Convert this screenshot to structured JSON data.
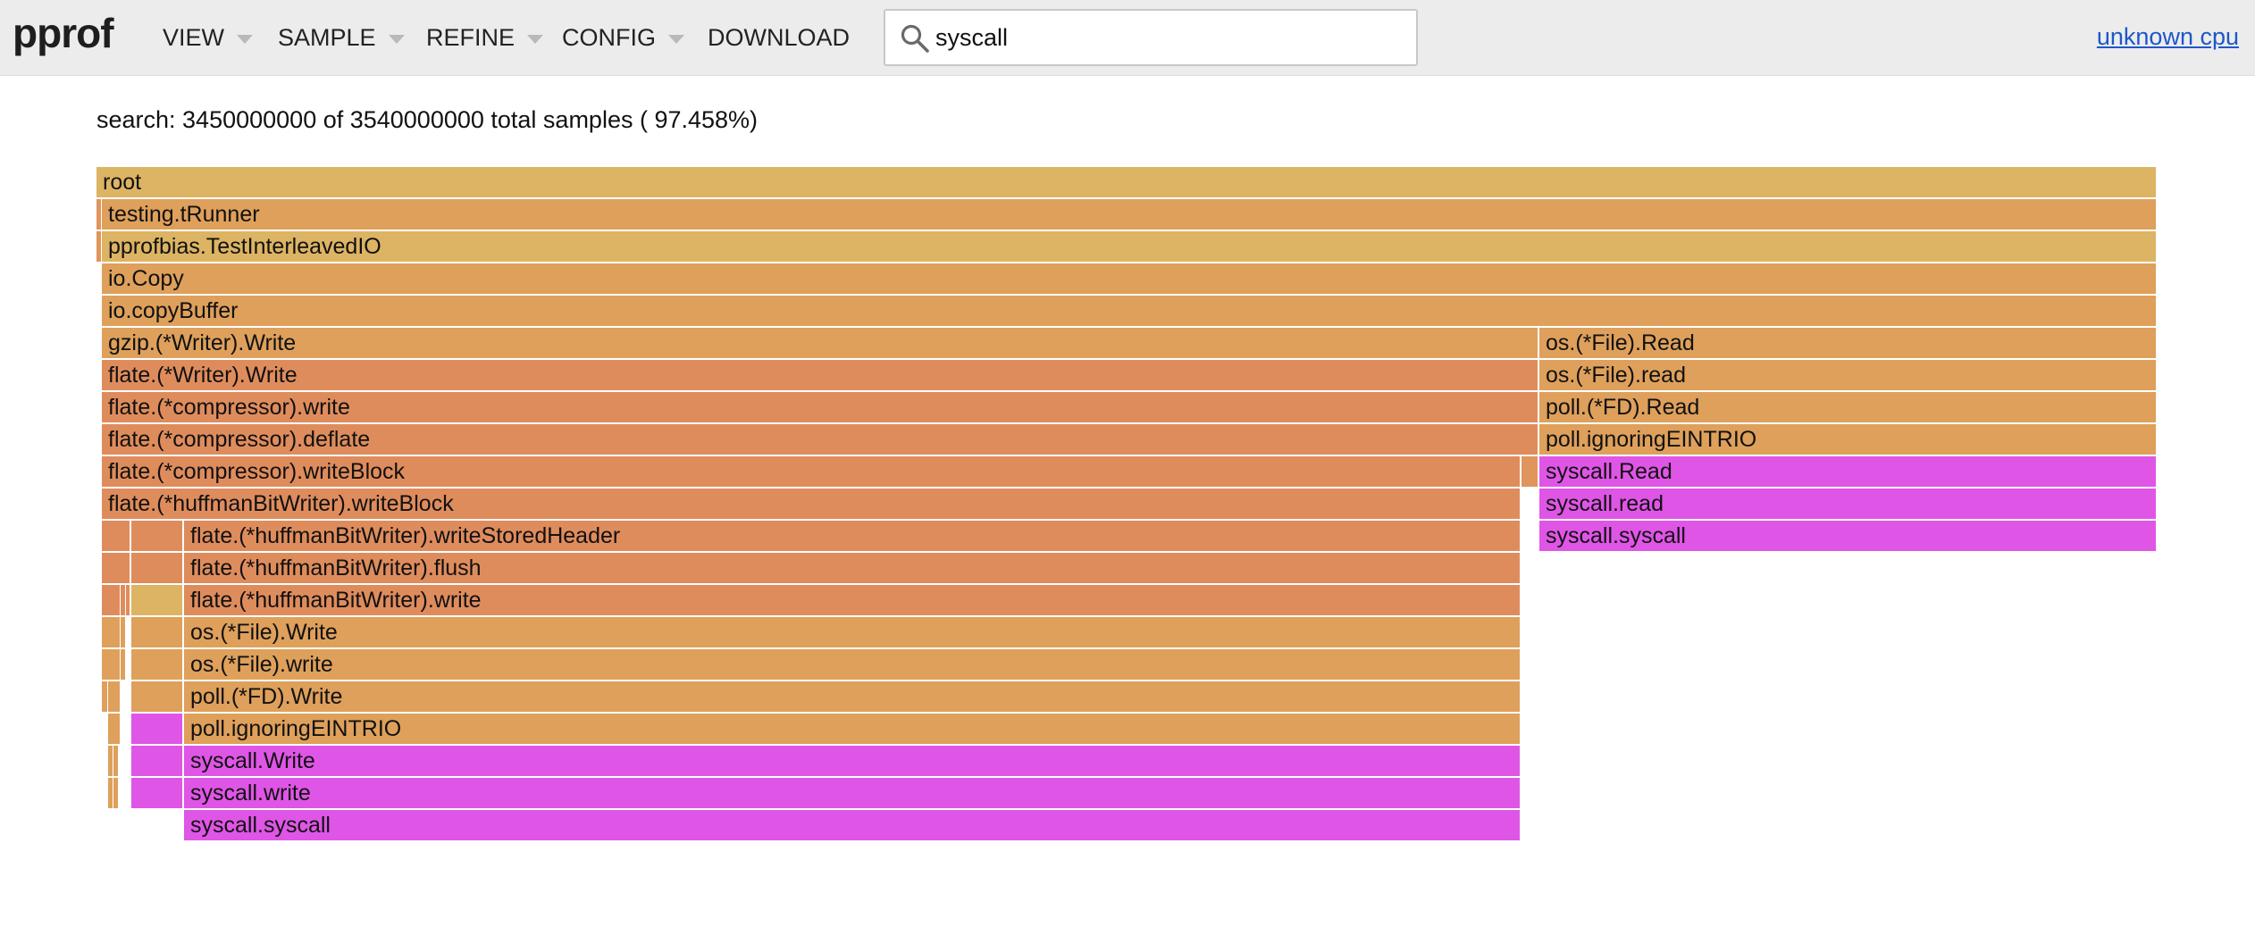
{
  "app": {
    "logo": "pprof"
  },
  "toolbar": {
    "menus": [
      {
        "label": "VIEW",
        "has_caret": true
      },
      {
        "label": "SAMPLE",
        "has_caret": true
      },
      {
        "label": "REFINE",
        "has_caret": true
      },
      {
        "label": "CONFIG",
        "has_caret": true
      },
      {
        "label": "DOWNLOAD",
        "has_caret": false
      }
    ],
    "search": {
      "value": "syscall",
      "icon": "search-icon"
    },
    "cpu_link": "unknown cpu"
  },
  "summary": "search: 3450000000 of 3540000000 total samples ( 97.458%)",
  "colors": {
    "gold": "#dcb463",
    "tan": "#dea05b",
    "orange": "#df8c5d",
    "magenta": "#df55e6",
    "mid": "#e0955c"
  },
  "flamegraph": {
    "frames": [
      {
        "label": "root",
        "color": "gold"
      },
      {
        "label": "testing.tRunner",
        "color": "tan"
      },
      {
        "label": "pprofbias.TestInterleavedIO",
        "color": "gold"
      },
      {
        "label": "io.Copy",
        "color": "tan"
      },
      {
        "label": "io.copyBuffer",
        "color": "tan"
      },
      {
        "label": "gzip.(*Writer).Write",
        "color": "tan"
      },
      {
        "label": "flate.(*Writer).Write",
        "color": "orange"
      },
      {
        "label": "flate.(*compressor).write",
        "color": "orange"
      },
      {
        "label": "flate.(*compressor).deflate",
        "color": "orange"
      },
      {
        "label": "flate.(*compressor).writeBlock",
        "color": "orange"
      },
      {
        "label": "flate.(*huffmanBitWriter).writeBlock",
        "color": "orange"
      },
      {
        "label": "flate.(*huffmanBitWriter).writeStoredHeader",
        "color": "orange"
      },
      {
        "label": "flate.(*huffmanBitWriter).flush",
        "color": "orange"
      },
      {
        "label": "flate.(*huffmanBitWriter).write",
        "color": "orange"
      },
      {
        "label": "os.(*File).Write",
        "color": "tan"
      },
      {
        "label": "os.(*File).write",
        "color": "tan"
      },
      {
        "label": "poll.(*FD).Write",
        "color": "tan"
      },
      {
        "label": "poll.ignoringEINTRIO",
        "color": "tan"
      },
      {
        "label": "syscall.Write",
        "color": "magenta"
      },
      {
        "label": "syscall.write",
        "color": "magenta"
      },
      {
        "label": "syscall.syscall",
        "color": "magenta"
      },
      {
        "label": "os.(*File).Read",
        "color": "tan"
      },
      {
        "label": "os.(*File).read",
        "color": "tan"
      },
      {
        "label": "poll.(*FD).Read",
        "color": "tan"
      },
      {
        "label": "poll.ignoringEINTRIO",
        "color": "tan"
      },
      {
        "label": "syscall.Read",
        "color": "magenta"
      },
      {
        "label": "syscall.read",
        "color": "magenta"
      },
      {
        "label": "syscall.syscall",
        "color": "magenta"
      },
      {
        "label": "",
        "color": "mid"
      },
      {
        "label": "",
        "color": "mid"
      },
      {
        "label": "",
        "color": "mid"
      },
      {
        "label": "",
        "color": "orange"
      },
      {
        "label": "",
        "color": "orange"
      },
      {
        "label": "",
        "color": "orange"
      },
      {
        "label": "",
        "color": "orange"
      },
      {
        "label": "",
        "color": "orange"
      },
      {
        "label": "",
        "color": "gold"
      },
      {
        "label": "",
        "color": "tan"
      },
      {
        "label": "",
        "color": "tan"
      },
      {
        "label": "",
        "color": "tan"
      },
      {
        "label": "",
        "color": "magenta"
      },
      {
        "label": "",
        "color": "magenta"
      },
      {
        "label": "",
        "color": "magenta"
      },
      {
        "label": "",
        "color": "orange"
      },
      {
        "label": "",
        "color": "orange"
      },
      {
        "label": "",
        "color": "tan"
      },
      {
        "label": "",
        "color": "tan"
      },
      {
        "label": "",
        "color": "tan"
      },
      {
        "label": "",
        "color": "tan"
      },
      {
        "label": "",
        "color": "tan"
      },
      {
        "label": "",
        "color": "tan"
      },
      {
        "label": "",
        "color": "tan"
      },
      {
        "label": "",
        "color": "tan"
      },
      {
        "label": "",
        "color": "tan"
      },
      {
        "label": "",
        "color": "tan"
      },
      {
        "label": "",
        "color": "tan"
      }
    ]
  }
}
